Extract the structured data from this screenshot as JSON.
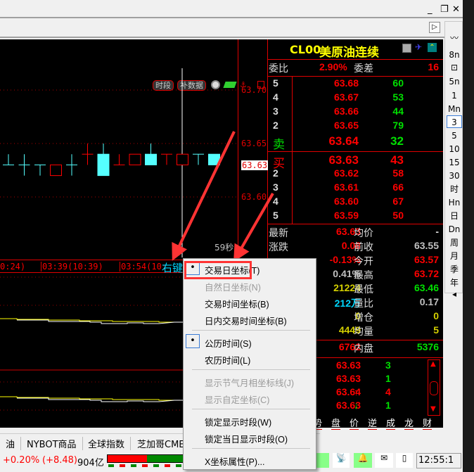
{
  "window": {
    "minimize": "_",
    "restore": "❐",
    "close": "✕",
    "scroll_right": "▷"
  },
  "chart": {
    "buttons": {
      "period": "时段",
      "fill_data": "补数据"
    },
    "price_labels": [
      "63.70",
      "63.65",
      "63.60"
    ],
    "current_price": "63.63",
    "countdown": "59秒",
    "time_labels": [
      "0:24)",
      "03:39(10:39)",
      "03:54(10:"
    ],
    "right_click_hint": "右键",
    "candles": [
      {
        "o": 63.63,
        "h": 63.64,
        "l": 63.63,
        "c": 63.63,
        "color": "cyan"
      },
      {
        "o": 63.63,
        "h": 63.64,
        "l": 63.62,
        "c": 63.63,
        "color": "cyan"
      },
      {
        "o": 63.63,
        "h": 63.63,
        "l": 63.62,
        "c": 63.63,
        "color": "cyan"
      },
      {
        "o": 63.62,
        "h": 63.63,
        "l": 63.62,
        "c": 63.63,
        "color": "red"
      },
      {
        "o": 63.63,
        "h": 63.64,
        "l": 63.62,
        "c": 63.63,
        "color": "cyan"
      },
      {
        "o": 63.64,
        "h": 63.65,
        "l": 63.63,
        "c": 63.64,
        "color": "red"
      },
      {
        "o": 63.64,
        "h": 63.65,
        "l": 63.62,
        "c": 63.62,
        "color": "cyan"
      },
      {
        "o": 63.63,
        "h": 63.64,
        "l": 63.63,
        "c": 63.63,
        "color": "red"
      },
      {
        "o": 63.63,
        "h": 63.64,
        "l": 63.63,
        "c": 63.64,
        "color": "red"
      },
      {
        "o": 63.64,
        "h": 63.65,
        "l": 63.63,
        "c": 63.63,
        "color": "cyan"
      },
      {
        "o": 63.64,
        "h": 63.64,
        "l": 63.63,
        "c": 63.64,
        "color": "red"
      },
      {
        "o": 63.63,
        "h": 63.64,
        "l": 63.63,
        "c": 63.64,
        "color": "red"
      },
      {
        "o": 63.64,
        "h": 63.64,
        "l": 63.63,
        "c": 63.64,
        "color": "cyan"
      },
      {
        "o": 63.64,
        "h": 63.64,
        "l": 63.63,
        "c": 63.63,
        "color": "cyan"
      }
    ]
  },
  "quote": {
    "code": "CL00",
    "name": "美原油连续",
    "ratio_label": "委比",
    "ratio": "2.90%",
    "diff_label": "委差",
    "diff": "16",
    "asks": [
      {
        "lv": "5",
        "p": "63.68",
        "v": "60"
      },
      {
        "lv": "4",
        "p": "63.67",
        "v": "53"
      },
      {
        "lv": "3",
        "p": "63.66",
        "v": "44"
      },
      {
        "lv": "2",
        "p": "63.65",
        "v": "79"
      },
      {
        "lv": "卖",
        "p": "63.64",
        "v": "32"
      }
    ],
    "bids": [
      {
        "lv": "买",
        "p": "63.63",
        "v": "43"
      },
      {
        "lv": "2",
        "p": "63.62",
        "v": "58"
      },
      {
        "lv": "3",
        "p": "63.61",
        "v": "66"
      },
      {
        "lv": "4",
        "p": "63.60",
        "v": "67"
      },
      {
        "lv": "5",
        "p": "63.59",
        "v": "50"
      }
    ],
    "stats": [
      {
        "l1": "最新",
        "v1": "63.63",
        "l2": "均价",
        "v2": "-"
      },
      {
        "l1": "涨跌",
        "v1": "0.08",
        "l2": "前收",
        "v2": "63.55"
      },
      {
        "l1": "",
        "v1": "-0.13%",
        "l2": "今开",
        "v2": "63.57"
      },
      {
        "l1": "",
        "v1": "0.41%",
        "l2": "最高",
        "v2": "63.72"
      },
      {
        "l1": "",
        "v1": "21224",
        "l2": "最低",
        "v2": "63.46"
      },
      {
        "l1": "",
        "v1": "212万",
        "l2": "量比",
        "v2": "0.17"
      },
      {
        "l1": "",
        "v1": "0",
        "l2": "增仓",
        "v2": "0"
      },
      {
        "l1": "",
        "v1": "4449",
        "l2": "均量",
        "v2": "5"
      }
    ],
    "outer": {
      "v1": "6762",
      "l2": "内盘",
      "v2": "5376"
    },
    "ticks": [
      {
        "p": "63.63",
        "dir": "",
        "v": "3"
      },
      {
        "p": "63.63",
        "dir": "",
        "v": "1"
      },
      {
        "p": "63.64",
        "dir": "↑",
        "v": "4"
      },
      {
        "p": "63.63",
        "dir": "↓",
        "v": "1"
      }
    ],
    "bottom_tabs": [
      "势",
      "盘",
      "价",
      "逆",
      "成",
      "龙",
      "财"
    ]
  },
  "periods": [
    "〰",
    "8n",
    "⊡",
    "5n",
    "1",
    "Mn",
    "3",
    "5",
    "10",
    "15",
    "30",
    "时",
    "Hn",
    "日",
    "Dn",
    "周",
    "月",
    "季",
    "年",
    "◂"
  ],
  "market_tabs": [
    "油",
    "NYBOT商品",
    "全球指数",
    "芝加哥CME"
  ],
  "status": {
    "change": "+0.20%",
    "change_pts": "(+8.48)",
    "amount": "904亿",
    "clock": "12:55:1"
  },
  "menu": {
    "items": [
      {
        "label": "交易日坐标(T)",
        "checked": true,
        "disabled": false
      },
      {
        "label": "自然日坐标(N)",
        "disabled": true
      },
      {
        "label": "交易时间坐标(B)",
        "disabled": false
      },
      {
        "label": "日内交易时间坐标(B)",
        "disabled": false
      },
      {
        "label": "公历时间(S)",
        "checked": true,
        "disabled": false
      },
      {
        "label": "农历时间(L)",
        "disabled": false
      },
      {
        "label": "显示节气月相坐标线(J)",
        "disabled": true
      },
      {
        "label": "显示自定坐标(C)",
        "disabled": true
      },
      {
        "label": "锁定显示时段(W)",
        "disabled": false
      },
      {
        "label": "锁定当日显示时段(O)",
        "disabled": false
      },
      {
        "label": "X坐标属性(P)...",
        "disabled": false
      }
    ],
    "check_mark": "•"
  }
}
